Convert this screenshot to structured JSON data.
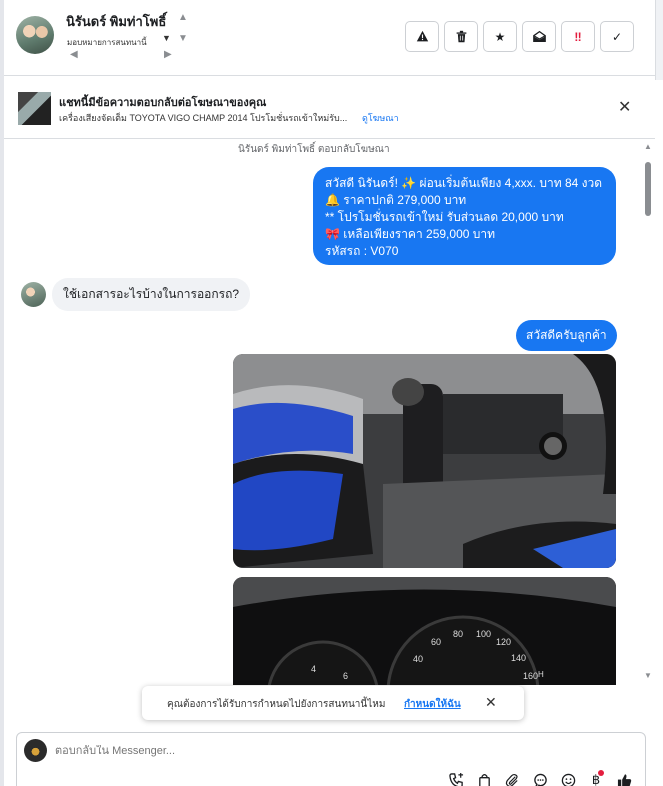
{
  "header": {
    "contact_name": "นิรันดร์ พิมท่าโพธิ์",
    "assign_label": "มอบหมายการสนทนานี้",
    "actions": {
      "report": "⚠",
      "delete": "🗑",
      "star": "★",
      "mark_unread": "✉",
      "important": "‼",
      "done": "✓"
    }
  },
  "ad_banner": {
    "title": "แชทนี้มีข้อความตอบกลับต่อโฆษณาของคุณ",
    "text": "เครื่องเสียงจัดเต็ม TOYOTA VIGO CHAMP 2014 โปรโมชั่นรถเข้าใหม่รับ...",
    "link": "ดูโฆษณา"
  },
  "conversation": {
    "context_note": "นิรันดร์ พิมท่าโพธิ์ ตอบกลับโฆษณา",
    "messages": [
      {
        "direction": "outgoing",
        "lines": [
          "สวัสดี นิรันดร์! ✨  ผ่อนเริ่มต้นเพียง 4,xxx. บาท 84 งวด",
          "🔔 ราคาปกติ 279,000 บาท",
          "** โปรโมชั่นรถเข้าใหม่ รับส่วนลด 20,000 บาท",
          "🎀  เหลือเพียงราคา 259,000 บาท",
          " รหัสรถ : V070"
        ]
      },
      {
        "direction": "incoming",
        "text": "ใช้เอกสารอะไรบ้างในการออกรถ?"
      },
      {
        "direction": "outgoing",
        "text": "สวัสดีครับลูกค้า"
      },
      {
        "direction": "outgoing",
        "type": "image",
        "alt": "gear-shift-interior-photo"
      },
      {
        "direction": "outgoing",
        "type": "image",
        "alt": "speedometer-cluster-photo"
      }
    ]
  },
  "toast": {
    "text": "คุณต้องการได้รับการกำหนดไปยังการสนทนานี้ไหม",
    "link": "กำหนดให้ฉัน"
  },
  "composer": {
    "placeholder": "ตอบกลับใน Messenger..."
  },
  "colors": {
    "accent": "#1877f2",
    "alert": "#e41e3f",
    "bubble_in": "#f0f2f5"
  }
}
